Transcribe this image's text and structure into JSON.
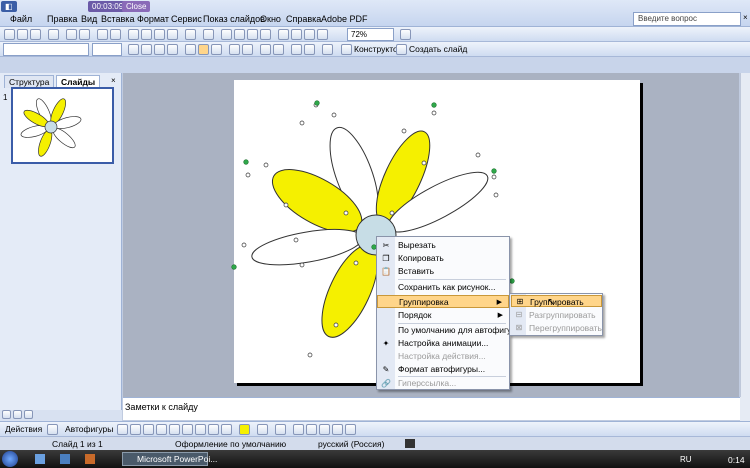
{
  "menu": {
    "items": [
      "Файл",
      "Правка",
      "Вид",
      "Вставка",
      "Формат",
      "Сервис",
      "Показ слайдов",
      "Окно",
      "Справка",
      "Adobe PDF"
    ],
    "quick_buttons": [
      "00:03:09",
      "Close"
    ],
    "help_placeholder": "Введите вопрос"
  },
  "toolbar": {
    "zoom": "72%",
    "designer_label": "Конструктор",
    "new_slide_label": "Создать слайд"
  },
  "panes": {
    "tab_outline": "Структура",
    "tab_slides": "Слайды",
    "slide_number": "1"
  },
  "context_menu": {
    "items": [
      {
        "label": "Вырезать",
        "icon": "scissors-icon",
        "enabled": true
      },
      {
        "label": "Копировать",
        "icon": "copy-icon",
        "enabled": true
      },
      {
        "label": "Вставить",
        "icon": "paste-icon",
        "enabled": true
      },
      {
        "label": "Сохранить как рисунок...",
        "enabled": true
      },
      {
        "label": "Группировка",
        "enabled": true,
        "submenu": true,
        "highlighted": true
      },
      {
        "label": "Порядок",
        "enabled": true,
        "submenu": true
      },
      {
        "label": "По умолчанию для автофигур",
        "enabled": true
      },
      {
        "label": "Настройка анимации...",
        "enabled": true
      },
      {
        "label": "Настройка действия...",
        "enabled": false
      },
      {
        "label": "Формат автофигуры...",
        "icon": "format-icon",
        "enabled": true
      },
      {
        "label": "Гиперссылка...",
        "enabled": false
      }
    ],
    "submenu": [
      {
        "label": "Группировать",
        "enabled": true,
        "highlighted": true
      },
      {
        "label": "Разгруппировать",
        "enabled": false
      },
      {
        "label": "Перегруппировать",
        "enabled": false
      }
    ]
  },
  "notes_placeholder": "Заметки к слайду",
  "drawing": {
    "actions_label": "Действия",
    "autoshapes_label": "Автофигуры"
  },
  "status": {
    "slide": "Слайд 1 из 1",
    "design": "Оформление по умолчанию",
    "language": "русский (Россия)"
  },
  "taskbar": {
    "app_label": "Microsoft PowerPoi...",
    "lang": "RU",
    "time": "0:14"
  },
  "colors": {
    "petal_yellow": "#f5f000",
    "petal_white": "#ffffff",
    "center": "#c7dde6",
    "highlight": "#ffd58a"
  }
}
